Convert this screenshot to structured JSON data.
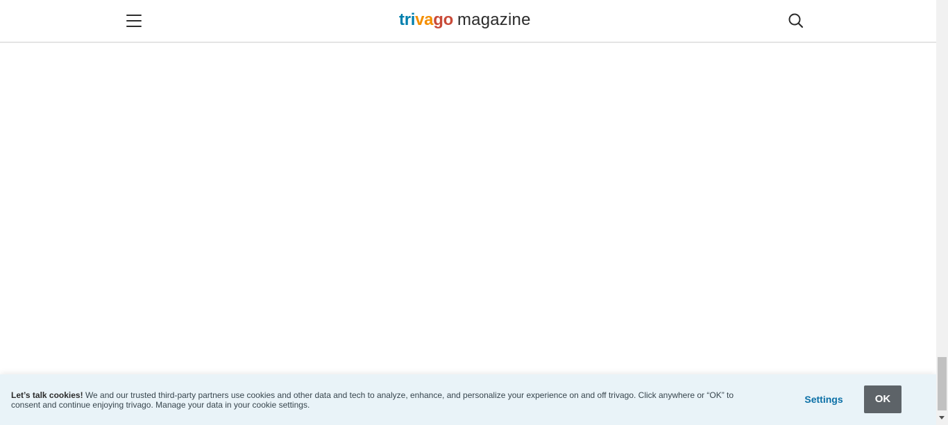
{
  "header": {
    "menu_icon": "hamburger-menu-icon",
    "logo": {
      "brand_parts": [
        "tri",
        "va",
        "go"
      ],
      "brand_colors": [
        "#007fad",
        "#f48f00",
        "#c94a38"
      ],
      "suffix": "magazine"
    },
    "search_icon": "search-icon"
  },
  "cookie_banner": {
    "title": "Let’s talk cookies!",
    "body": "We and our trusted third-party partners use cookies and other data and tech to analyze, enhance, and personalize your experience on and off trivago. Click anywhere or “OK” to consent and continue enjoying trivago. Manage your data in your cookie settings.",
    "settings_label": "Settings",
    "ok_label": "OK",
    "settings_color": "#0a6fa6",
    "ok_background": "#5d6368"
  }
}
